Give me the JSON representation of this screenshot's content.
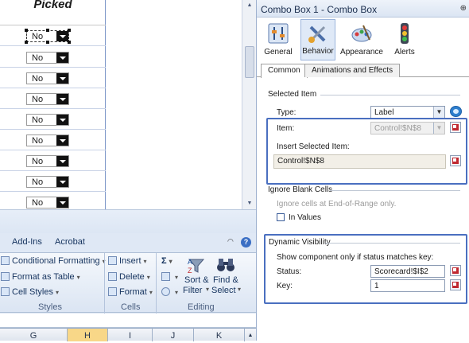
{
  "sheet": {
    "column_header": "Picked",
    "combos": [
      "No",
      "No",
      "No",
      "No",
      "No",
      "No",
      "No",
      "No",
      "No"
    ]
  },
  "ribbon": {
    "tabs": [
      "Add-Ins",
      "Acrobat"
    ],
    "styles": {
      "conditional_formatting": "Conditional Formatting",
      "format_as_table": "Format as Table",
      "cell_styles": "Cell Styles",
      "label": "Styles"
    },
    "cells": {
      "insert": "Insert",
      "delete": "Delete",
      "format": "Format",
      "label": "Cells"
    },
    "editing": {
      "sigma": "Σ",
      "sort_filter_1": "Sort &",
      "sort_filter_2": "Filter",
      "find_select_1": "Find &",
      "find_select_2": "Select",
      "label": "Editing"
    },
    "columns": [
      "G",
      "H",
      "I",
      "J",
      "K"
    ],
    "active_column": "H"
  },
  "panel": {
    "title": "Combo Box 1 - Combo Box",
    "categories": [
      "General",
      "Behavior",
      "Appearance",
      "Alerts"
    ],
    "active_category": "Behavior",
    "subtabs": [
      "Common",
      "Animations and Effects"
    ],
    "active_subtab": "Common",
    "selected_item": {
      "heading": "Selected Item",
      "type_label": "Type:",
      "type_value": "Label",
      "item_label": "Item:",
      "item_value": "Control!$N$8",
      "insert_label": "Insert Selected Item:",
      "insert_value": "Control!$N$8"
    },
    "ignore_blank": {
      "heading": "Ignore Blank Cells",
      "hint": "Ignore cells at End-of-Range only.",
      "in_values": "In Values"
    },
    "dynamic_visibility": {
      "heading": "Dynamic Visibility",
      "show_label": "Show component only if status matches key:",
      "status_label": "Status:",
      "status_value": "Scorecard!$I$2",
      "key_label": "Key:",
      "key_value": "1"
    }
  },
  "colors": {
    "accent": "#4a6fc0",
    "ribbon_bg": "#dfe8f5",
    "active_col": "#f8d788"
  }
}
